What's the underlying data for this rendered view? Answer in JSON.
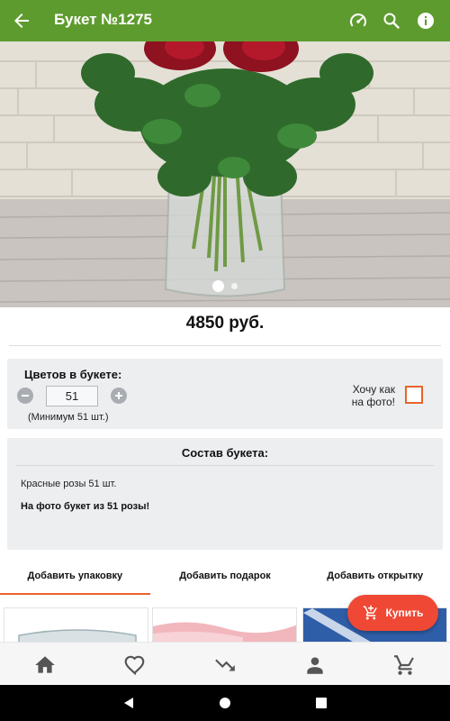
{
  "header": {
    "title": "Букет №1275",
    "back_icon": "arrow-left-icon",
    "actions": [
      "speedometer-icon",
      "search-icon",
      "info-icon"
    ],
    "color": "#5e9b2e"
  },
  "gallery": {
    "image": "bouquet-of-red-roses-in-glass-vase",
    "pages": 2,
    "active_page": 1
  },
  "price": "4850 руб.",
  "quantity": {
    "label": "Цветов в букете:",
    "value": "51",
    "minimum": "(Минимум 51 шт.)",
    "like_photo_line1": "Хочу как",
    "like_photo_line2": "на фото!",
    "like_photo_checked": false
  },
  "composition": {
    "title": "Состав букета:",
    "items": "Красные розы 51 шт.",
    "note": "На фото букет из 51 розы!"
  },
  "tabs": [
    {
      "label": "Добавить упаковку",
      "active": true
    },
    {
      "label": "Добавить подарок",
      "active": false
    },
    {
      "label": "Добавить открытку",
      "active": false
    }
  ],
  "buy_button": {
    "label": "Купить",
    "icon": "add-to-cart-icon",
    "color": "#ef4834"
  },
  "bottom_nav": [
    "home-icon",
    "favorite-icon",
    "trending-down-icon",
    "account-icon",
    "cart-icon"
  ],
  "accent_color": "#e8632b"
}
